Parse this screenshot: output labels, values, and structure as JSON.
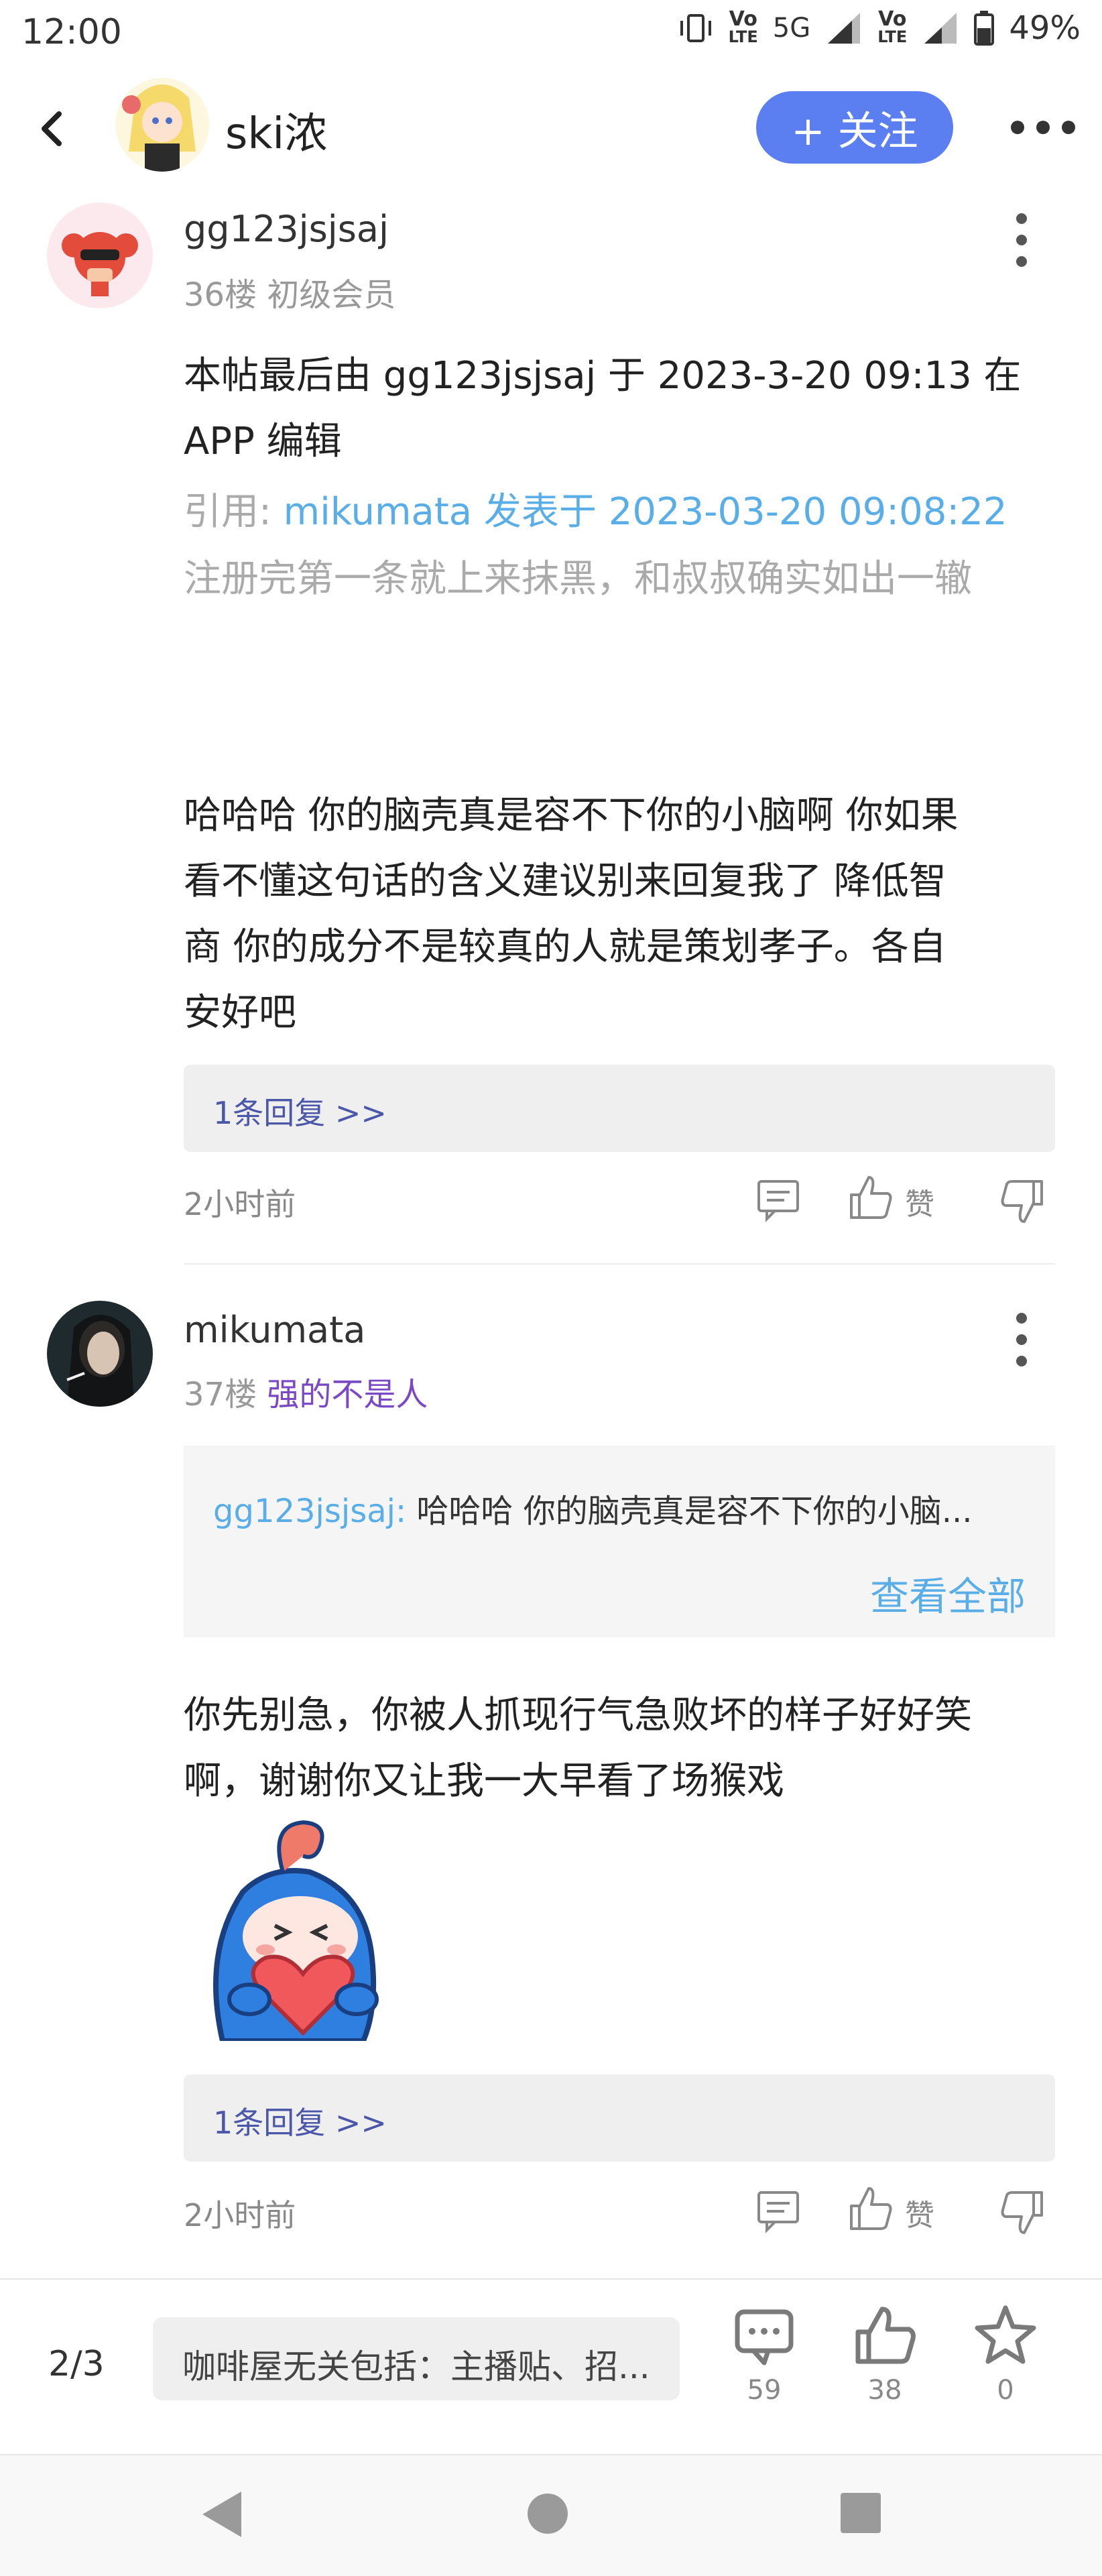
{
  "status_bar": {
    "time": "12:00",
    "network": "5G",
    "lte_label": "LTE",
    "vo_label": "Vo",
    "battery": "49%"
  },
  "header": {
    "title": "ski浓",
    "follow_label": "+ 关注"
  },
  "posts": [
    {
      "username": "gg123jsjsaj",
      "floor": "36楼",
      "title": "初级会员",
      "body_lines": [
        "本帖最后由 gg123jsjsaj 于 2023-3-20 09:13 在",
        "APP 编辑"
      ],
      "quote_prefix": "引用: ",
      "quote_source": "mikumata 发表于 2023-03-20 09:08:22",
      "quote_text": "注册完第一条就上来抹黑，和叔叔确实如出一辙",
      "reply_lines": [
        "哈哈哈 你的脑壳真是容不下你的小脑啊 你如果",
        "看不懂这句话的含义建议别来回复我了 降低智",
        "商  你的成分不是较真的人就是策划孝子。各自",
        "安好吧"
      ],
      "replies_label": "1条回复 >>",
      "time": "2小时前",
      "like_label": "赞"
    },
    {
      "username": "mikumata",
      "floor": "37楼",
      "title": "强的不是人",
      "quoted_user": "gg123jsjsaj:",
      "quoted_text": " 哈哈哈 你的脑壳真是容不下你的小脑...",
      "view_all": "查看全部",
      "body_lines": [
        "你先别急，你被人抓现行气急败坏的样子好好笑",
        "啊，谢谢你又让我一大早看了场猴戏"
      ],
      "replies_label": "1条回复 >>",
      "time": "2小时前",
      "like_label": "赞"
    }
  ],
  "bottom_bar": {
    "page_indicator": "2/3",
    "thread_title": "咖啡屋无关包括：主播贴、招...",
    "comments": "59",
    "likes": "38",
    "favorites": "0"
  },
  "icons": {
    "back": "chevron-left-icon",
    "more": "more-horizontal-icon",
    "kebab": "more-vertical-icon",
    "comment": "comment-icon",
    "like": "thumbs-up-icon",
    "dislike": "thumbs-down-icon",
    "star": "star-icon"
  },
  "colors": {
    "accent": "#5b7ff0",
    "link": "#5aaee8",
    "title_purple": "#7b49c4"
  }
}
